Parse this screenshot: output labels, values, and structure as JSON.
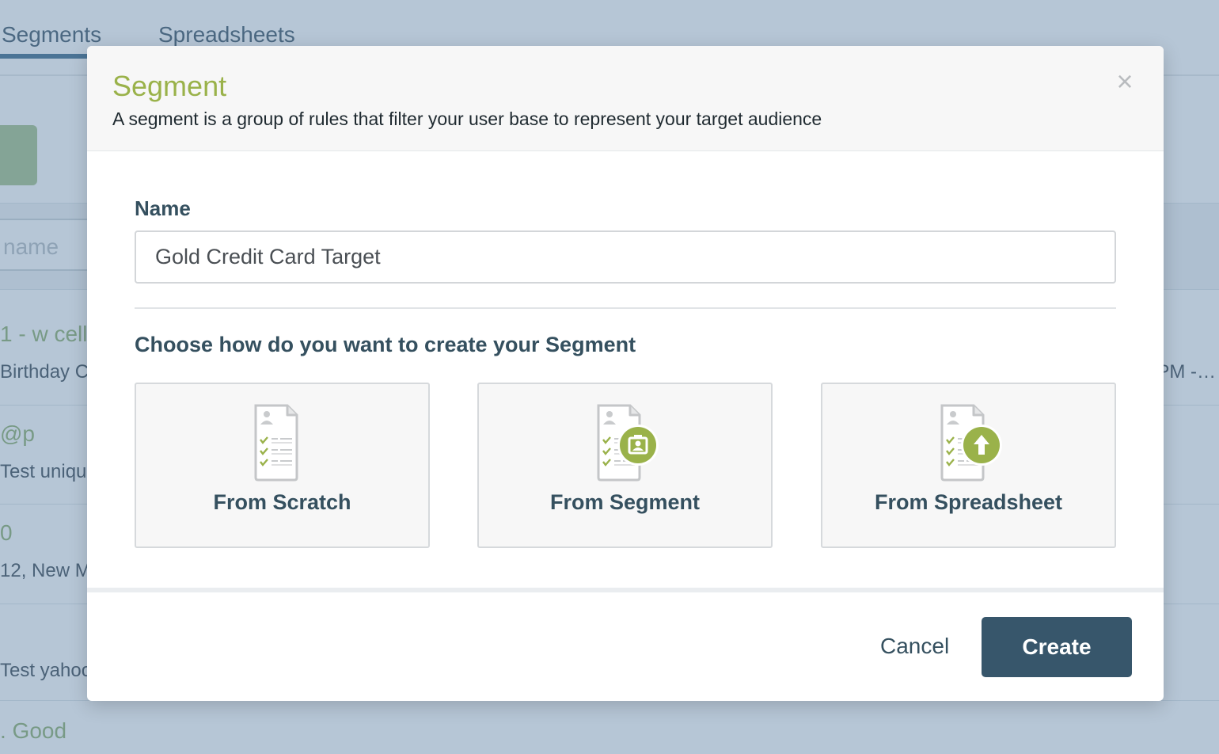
{
  "background": {
    "tabs": [
      "Segments",
      "Spreadsheets"
    ],
    "search_placeholder": "name",
    "rows": [
      {
        "title": "1 - w cell",
        "subtitle": "Birthday C",
        "right": "PM -…"
      },
      {
        "title": "@p",
        "subtitle": "Test uniqu",
        "right": ""
      },
      {
        "title": "0",
        "subtitle": "12, New M",
        "right": ""
      },
      {
        "title": "",
        "subtitle": "Test yahoo",
        "right": ""
      },
      {
        "title": ". Good",
        "subtitle": "",
        "right": ""
      }
    ]
  },
  "modal": {
    "title": "Segment",
    "subtitle": "A segment is a group of rules that filter your user base to represent your target audience",
    "close_symbol": "×",
    "name_label": "Name",
    "name_value": "Gold Credit Card Target",
    "choose_heading": "Choose how do you want to create your Segment",
    "options": [
      {
        "label": "From Scratch",
        "icon": "document-checklist-icon"
      },
      {
        "label": "From Segment",
        "icon": "document-segment-icon"
      },
      {
        "label": "From Spreadsheet",
        "icon": "document-upload-icon"
      }
    ],
    "cancel_label": "Cancel",
    "create_label": "Create"
  },
  "colors": {
    "accent_green": "#9ab24a",
    "primary_button": "#37566b",
    "overlay": "#5d80a3"
  }
}
